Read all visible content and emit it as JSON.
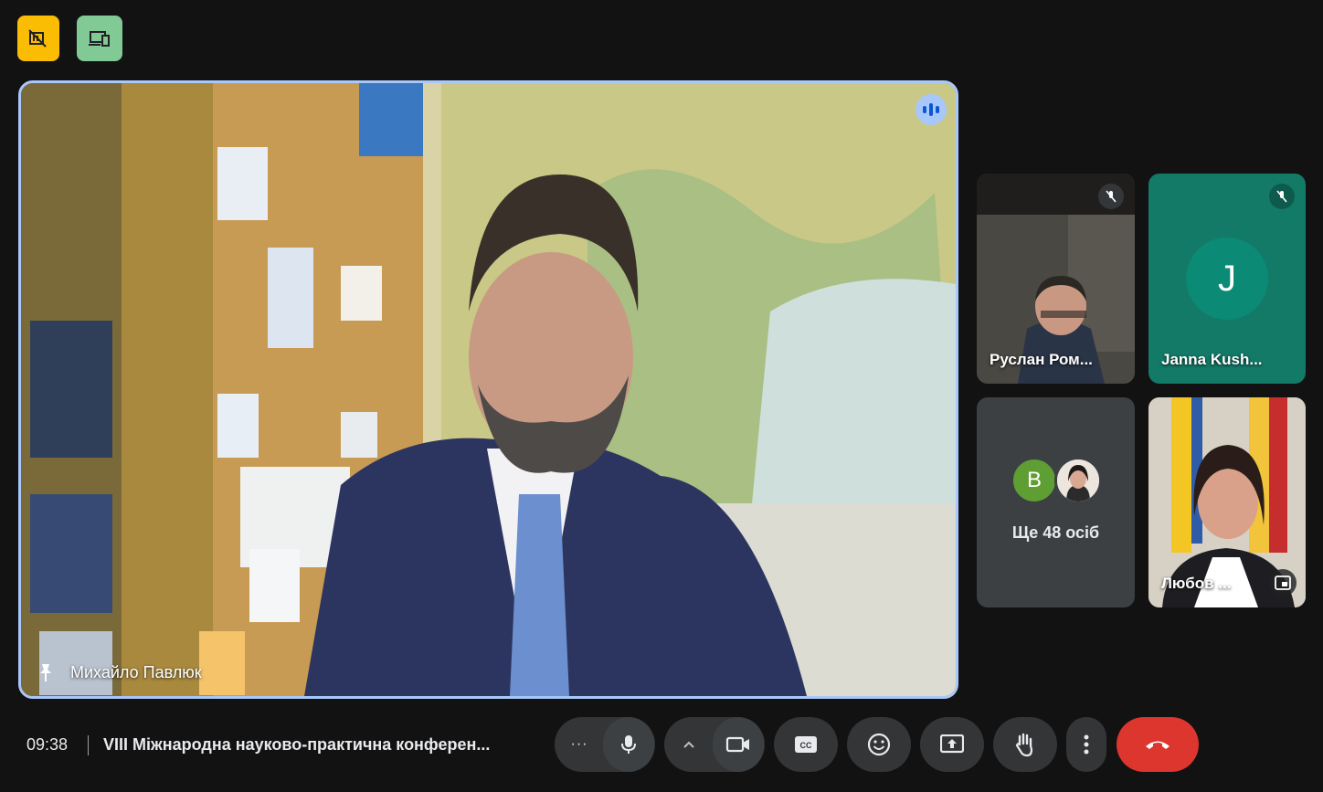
{
  "top_buttons": [
    {
      "icon": "no-video-grid-icon",
      "color": "#fbbc04"
    },
    {
      "icon": "devices-icon",
      "color": "#81c995"
    }
  ],
  "main_speaker": {
    "name": "Михайло Павлюк",
    "speaking": true
  },
  "tiles": [
    {
      "name": "Руслан Ром...",
      "muted": true
    },
    {
      "name": "Janna Kush...",
      "initial": "J",
      "muted": true
    },
    {
      "more_count_label": "Ще 48 осіб",
      "avatar_initial": "B"
    },
    {
      "name": "Любов ..."
    }
  ],
  "bottom_bar": {
    "time": "09:38",
    "meeting_title": "VIII Міжнародна науково-практична конферен...",
    "more_dots": "···"
  },
  "colors": {
    "accent": "#a8c7fa",
    "end_call": "#dc362e",
    "control_bg": "#333537"
  }
}
